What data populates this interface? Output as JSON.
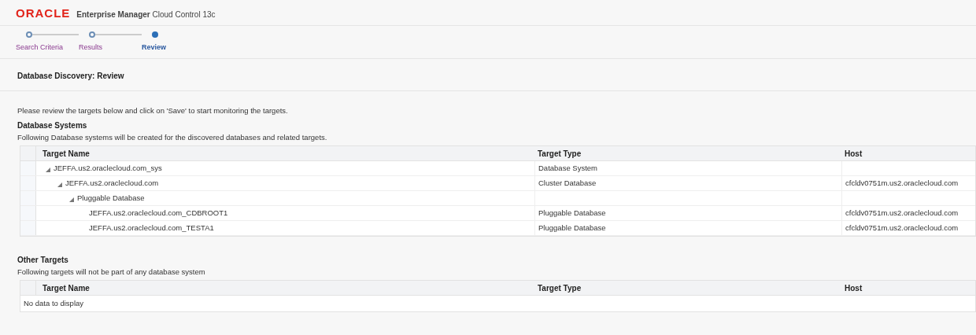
{
  "header": {
    "logo": "ORACLE",
    "product_bold": "Enterprise Manager",
    "product": "Cloud Control 13c"
  },
  "steps": [
    {
      "label": "Search Criteria",
      "selected": false
    },
    {
      "label": "Results",
      "selected": false
    },
    {
      "label": "Review",
      "selected": true
    }
  ],
  "page_title": "Database Discovery: Review",
  "instruction": "Please review the targets below and click on 'Save' to start monitoring the targets.",
  "database_systems": {
    "title": "Database Systems",
    "description": "Following Database systems will be created for the discovered databases and related targets.",
    "columns": [
      "Target Name",
      "Target Type",
      "Host"
    ],
    "rows": [
      {
        "name": "JEFFA.us2.oraclecloud.com_sys",
        "type": "Database System",
        "expanded": true,
        "children": [
          {
            "name": "JEFFA.us2.oraclecloud.com",
            "type": "Cluster Database",
            "host": "cfcldv0751m.us2.oraclecloud.com",
            "expanded": true,
            "children": [
              {
                "name": "Pluggable Database",
                "expanded": true,
                "children": [
                  {
                    "name": "JEFFA.us2.oraclecloud.com_CDBROOT1",
                    "type": "Pluggable Database",
                    "host": "cfcldv0751m.us2.oraclecloud.com"
                  },
                  {
                    "name": "JEFFA.us2.oraclecloud.com_TESTA1",
                    "type": "Pluggable Database",
                    "host": "cfcldv0751m.us2.oraclecloud.com"
                  }
                ]
              }
            ]
          }
        ]
      }
    ]
  },
  "other_targets": {
    "title": "Other Targets",
    "description": "Following targets will not be part of any database system",
    "columns": [
      "Target Name",
      "Target Type",
      "Host"
    ],
    "empty_text": "No data to display"
  }
}
